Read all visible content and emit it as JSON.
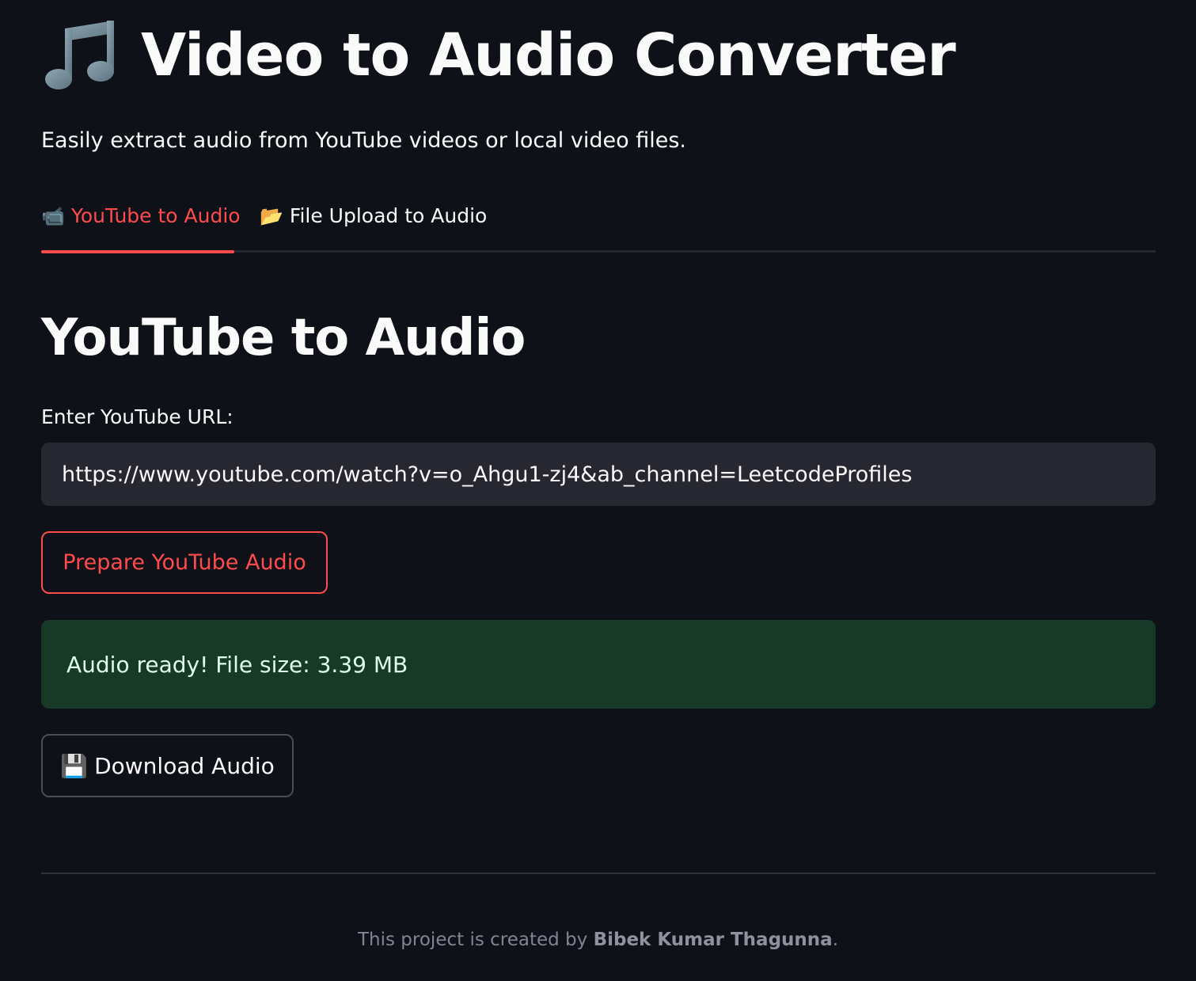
{
  "header": {
    "icon": "music-note-icon",
    "title": "Video to Audio Converter",
    "subtitle": "Easily extract audio from YouTube videos or local video files."
  },
  "tabs": [
    {
      "icon": "video-camera-icon",
      "label": "YouTube to Audio",
      "active": true
    },
    {
      "icon": "open-folder-icon",
      "label": "File Upload to Audio",
      "active": false
    }
  ],
  "youtube": {
    "heading": "YouTube to Audio",
    "url_label": "Enter YouTube URL:",
    "url_value": "https://www.youtube.com/watch?v=o_Ahgu1-zj4&ab_channel=LeetcodeProfiles",
    "prepare_button": "Prepare YouTube Audio",
    "success_message": "Audio ready! File size: 3.39 MB",
    "download_icon": "floppy-disk-icon",
    "download_button": "Download Audio"
  },
  "footer": {
    "prefix": "This project is created by ",
    "author": "Bibek Kumar Thagunna",
    "suffix": "."
  },
  "colors": {
    "background": "#0e1117",
    "accent": "#ff4b4b",
    "input_bg": "#262730",
    "success_bg": "#173928"
  }
}
